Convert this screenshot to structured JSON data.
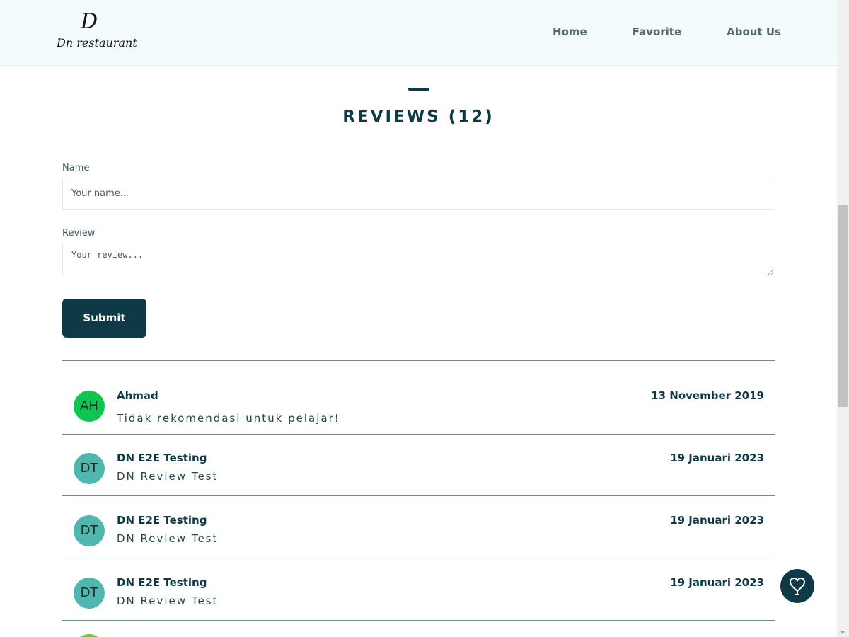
{
  "header": {
    "logo_mark": "D",
    "logo_text": "Dn restaurant",
    "nav": [
      "Home",
      "Favorite",
      "About Us"
    ]
  },
  "reviews_section": {
    "title": "REVIEWS (12)"
  },
  "form": {
    "name_label": "Name",
    "name_placeholder": "Your name...",
    "review_label": "Review",
    "review_placeholder": "Your review...",
    "submit_label": "Submit"
  },
  "reviews": [
    {
      "initials": "AH",
      "name": "Ahmad",
      "date": "13 November 2019",
      "text": "Tidak rekomendasi untuk pelajar!",
      "avatar_color": "#0fc54f"
    },
    {
      "initials": "DT",
      "name": "DN E2E Testing",
      "date": "19 Januari 2023",
      "text": "DN Review Test",
      "avatar_color": "#4fb7ae"
    },
    {
      "initials": "DT",
      "name": "DN E2E Testing",
      "date": "19 Januari 2023",
      "text": "DN Review Test",
      "avatar_color": "#4fb7ae"
    },
    {
      "initials": "DT",
      "name": "DN E2E Testing",
      "date": "19 Januari 2023",
      "text": "DN Review Test",
      "avatar_color": "#4fb7ae"
    }
  ],
  "colors": {
    "primary": "#0e3a47",
    "header_bg": "#f4fbfd"
  },
  "icons": {
    "fab": "heart-icon"
  }
}
